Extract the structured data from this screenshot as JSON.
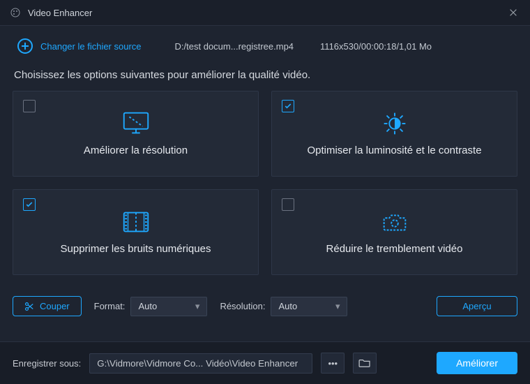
{
  "app": {
    "title": "Video Enhancer"
  },
  "toolbar": {
    "change_source": "Changer le fichier source",
    "file_path": "D:/test docum...registree.mp4",
    "file_info": "1116x530/00:00:18/1,01 Mo"
  },
  "instruction": "Choisissez les options suivantes pour améliorer la qualité vidéo.",
  "cards": {
    "resolution": {
      "label": "Améliorer la résolution",
      "checked": false
    },
    "brightness": {
      "label": "Optimiser la luminosité et le contraste",
      "checked": true
    },
    "noise": {
      "label": "Supprimer les bruits numériques",
      "checked": true
    },
    "shake": {
      "label": "Réduire le tremblement vidéo",
      "checked": false
    }
  },
  "controls": {
    "cut": "Couper",
    "format_label": "Format:",
    "format_value": "Auto",
    "resolution_label": "Résolution:",
    "resolution_value": "Auto",
    "preview": "Aperçu"
  },
  "footer": {
    "save_label": "Enregistrer sous:",
    "save_path": "G:\\Vidmore\\Vidmore Co... Vidéo\\Video Enhancer",
    "enhance": "Améliorer"
  }
}
